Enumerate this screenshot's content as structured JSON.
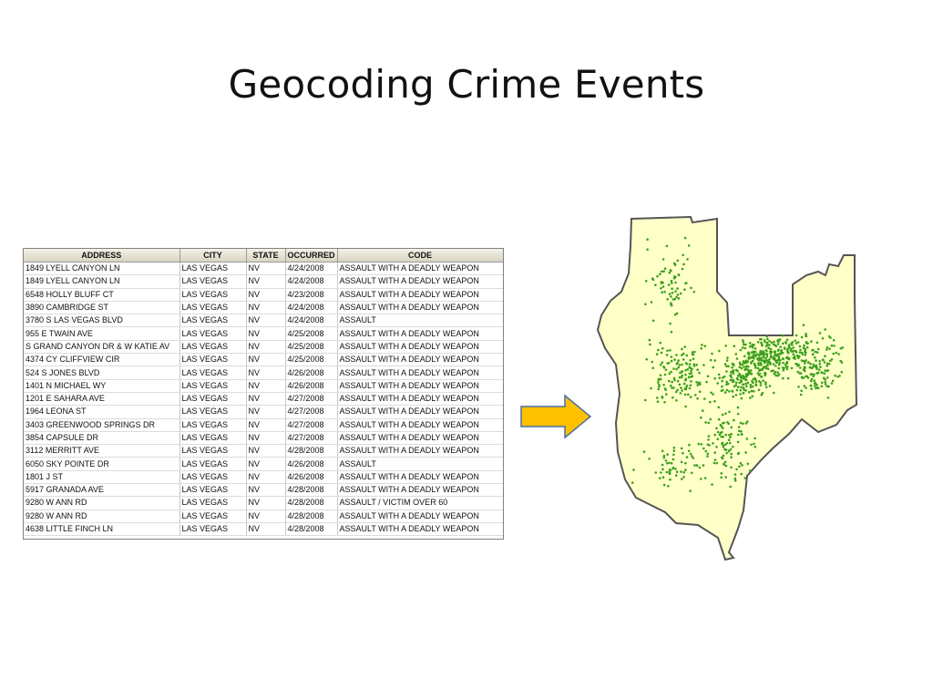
{
  "title": "Geocoding Crime Events",
  "table": {
    "columns": [
      "ADDRESS",
      "CITY",
      "STATE",
      "OCCURRED",
      "CODE"
    ],
    "rows": [
      [
        "1849 LYELL CANYON LN",
        "LAS VEGAS",
        "NV",
        "4/24/2008",
        "ASSAULT WITH A DEADLY WEAPON"
      ],
      [
        "1849 LYELL CANYON LN",
        "LAS VEGAS",
        "NV",
        "4/24/2008",
        "ASSAULT WITH A DEADLY WEAPON"
      ],
      [
        "6548 HOLLY BLUFF CT",
        "LAS VEGAS",
        "NV",
        "4/23/2008",
        "ASSAULT WITH A DEADLY WEAPON"
      ],
      [
        "3890 CAMBRIDGE ST",
        "LAS VEGAS",
        "NV",
        "4/24/2008",
        "ASSAULT WITH A DEADLY WEAPON"
      ],
      [
        "3780 S LAS VEGAS BLVD",
        "LAS VEGAS",
        "NV",
        "4/24/2008",
        "ASSAULT"
      ],
      [
        "955 E TWAIN AVE",
        "LAS VEGAS",
        "NV",
        "4/25/2008",
        "ASSAULT WITH A DEADLY WEAPON"
      ],
      [
        "S GRAND CANYON DR & W KATIE AV",
        "LAS VEGAS",
        "NV",
        "4/25/2008",
        "ASSAULT WITH A DEADLY WEAPON"
      ],
      [
        "4374 CY CLIFFVIEW CIR",
        "LAS VEGAS",
        "NV",
        "4/25/2008",
        "ASSAULT WITH A DEADLY WEAPON"
      ],
      [
        "524 S JONES BLVD",
        "LAS VEGAS",
        "NV",
        "4/26/2008",
        "ASSAULT WITH A DEADLY WEAPON"
      ],
      [
        "1401 N MICHAEL WY",
        "LAS VEGAS",
        "NV",
        "4/26/2008",
        "ASSAULT WITH A DEADLY WEAPON"
      ],
      [
        "1201 E SAHARA AVE",
        "LAS VEGAS",
        "NV",
        "4/27/2008",
        "ASSAULT WITH A DEADLY WEAPON"
      ],
      [
        "1964 LEONA ST",
        "LAS VEGAS",
        "NV",
        "4/27/2008",
        "ASSAULT WITH A DEADLY WEAPON"
      ],
      [
        "3403 GREENWOOD SPRINGS DR",
        "LAS VEGAS",
        "NV",
        "4/27/2008",
        "ASSAULT WITH A DEADLY WEAPON"
      ],
      [
        "3854 CAPSULE DR",
        "LAS VEGAS",
        "NV",
        "4/27/2008",
        "ASSAULT WITH A DEADLY WEAPON"
      ],
      [
        "3112 MERRITT AVE",
        "LAS VEGAS",
        "NV",
        "4/28/2008",
        "ASSAULT WITH A DEADLY WEAPON"
      ],
      [
        "6050 SKY POINTE DR",
        "LAS VEGAS",
        "NV",
        "4/26/2008",
        "ASSAULT"
      ],
      [
        "1801 J ST",
        "LAS VEGAS",
        "NV",
        "4/26/2008",
        "ASSAULT WITH A DEADLY WEAPON"
      ],
      [
        "5917 GRANADA AVE",
        "LAS VEGAS",
        "NV",
        "4/28/2008",
        "ASSAULT WITH A DEADLY WEAPON"
      ],
      [
        "9280 W ANN RD",
        "LAS VEGAS",
        "NV",
        "4/28/2008",
        "ASSAULT / VICTIM OVER 60"
      ],
      [
        "9280 W ANN RD",
        "LAS VEGAS",
        "NV",
        "4/28/2008",
        "ASSAULT WITH A DEADLY WEAPON"
      ],
      [
        "4638 LITTLE FINCH LN",
        "LAS VEGAS",
        "NV",
        "4/28/2008",
        "ASSAULT WITH A DEADLY WEAPON"
      ]
    ]
  },
  "arrow": {
    "icon": "right-arrow-icon",
    "fill": "#FFC000",
    "stroke": "#4A6FA5"
  },
  "map": {
    "fill": "#FFFFC8",
    "outline": "#555555",
    "point_color": "#3CA01E"
  }
}
